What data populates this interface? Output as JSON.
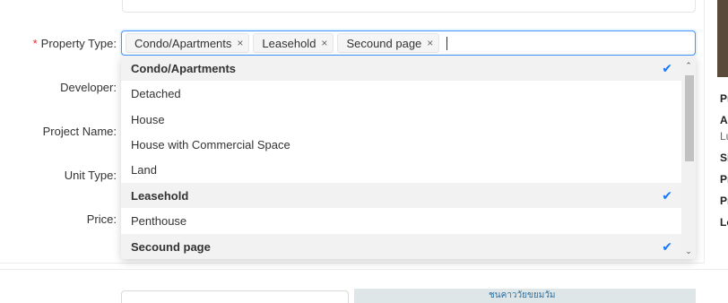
{
  "form": {
    "labels": {
      "property_type": "Property Type",
      "developer": "Developer",
      "project_name": "Project Name",
      "unit_type": "Unit Type",
      "price": "Price"
    },
    "required_mark": "*",
    "colon": ":"
  },
  "property_select": {
    "selected_tags": [
      {
        "label": "Condo/Apartments"
      },
      {
        "label": "Leasehold"
      },
      {
        "label": "Secound page"
      }
    ],
    "tag_close_glyph": "×"
  },
  "dropdown": {
    "options": [
      {
        "label": "Condo/Apartments",
        "selected": true
      },
      {
        "label": "Detached",
        "selected": false
      },
      {
        "label": "House",
        "selected": false
      },
      {
        "label": "House with Commercial Space",
        "selected": false
      },
      {
        "label": "Land",
        "selected": false
      },
      {
        "label": "Leasehold",
        "selected": true
      },
      {
        "label": "Penthouse",
        "selected": false
      },
      {
        "label": "Secound page",
        "selected": true
      }
    ],
    "check_glyph": "✔",
    "scroll_up_glyph": "⌃",
    "scroll_down_glyph": "⌄"
  },
  "right_panel": {
    "lines": [
      "Pr",
      "Ac",
      "Lu",
      "Si",
      "Pr",
      "Pr",
      "Lo"
    ]
  },
  "map": {
    "label": "ชนคาววัยขยมวัม"
  },
  "colors": {
    "accent": "#4096ff",
    "check": "#1677ff",
    "required": "#f5222d",
    "selected_bg": "#f2f2f2"
  }
}
